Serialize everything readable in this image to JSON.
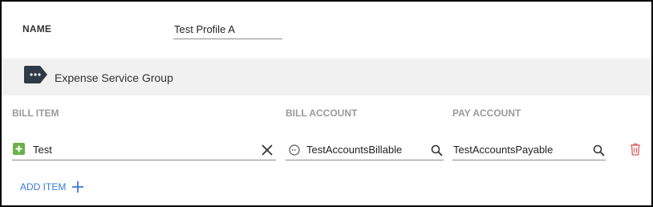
{
  "profile": {
    "name_label": "NAME",
    "name_value": "Test Profile A"
  },
  "group": {
    "title": "Expense Service Group",
    "icon": "tag-ellipsis-icon"
  },
  "columns": {
    "bill_item": "BILL ITEM",
    "bill_account": "BILL ACCOUNT",
    "pay_account": "PAY ACCOUNT"
  },
  "row": {
    "bill_item": "Test",
    "bill_account": "TestAccountsBillable",
    "pay_account": "TestAccountsPayable",
    "bill_item_icon": "plus-square-icon",
    "bill_account_icon": "ellipsis-circle-icon"
  },
  "actions": {
    "add_item": "ADD ITEM"
  },
  "colors": {
    "accent": "#3a7bd5",
    "delete": "#e05a5a",
    "item_badge": "#6ab04c",
    "group_band": "#f1f1f1",
    "tag_icon": "#2f3a46"
  }
}
